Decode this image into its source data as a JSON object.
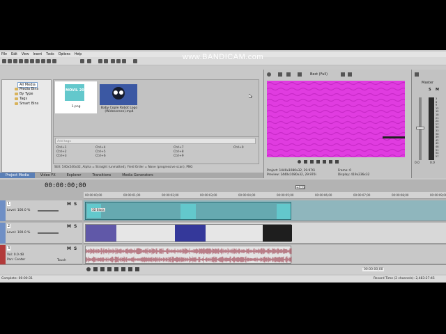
{
  "watermark": "www.BANDICAM.com",
  "menu": [
    "File",
    "Edit",
    "View",
    "Insert",
    "Tools",
    "Options",
    "Help"
  ],
  "explorer_tree": [
    "All Media",
    "Media Bins",
    "By Type",
    "Tags",
    "Smart Bins"
  ],
  "media": [
    {
      "label": "1.png",
      "thumb_text": "MOVIL 2019"
    },
    {
      "label": "Baby Cople Robot Logo (Widescreen).mp4",
      "thumb_text": ""
    }
  ],
  "tags_placeholder": "Add tags",
  "shortcuts": [
    "Ctrl+1",
    "Ctrl+2",
    "Ctrl+3",
    "Ctrl+4",
    "Ctrl+5",
    "Ctrl+6",
    "Ctrl+7",
    "Ctrl+8",
    "Ctrl+9",
    "Ctrl+0"
  ],
  "media_info": "Still: 540x540x32, Alpha = Straight (unmatted), Field Order = None (progressive scan), PNG",
  "left_tabs": [
    "Project Media",
    "Video FX",
    "Explorer",
    "Transitions",
    "Media Generators"
  ],
  "preview": {
    "quality": "Best (Full)",
    "project": "1440x1080x32, 29.970i",
    "preview_res": "1440x1080x32, 29.970i",
    "frame": "0",
    "display": "419x236x32",
    "project_label": "Project:",
    "preview_label": "Preview:",
    "frame_label": "Frame:",
    "display_label": "Display:"
  },
  "master": {
    "label": "Master",
    "left": "0.0",
    "right": "0.0",
    "db_scale": [
      "3",
      "6",
      "9",
      "12",
      "15",
      "18",
      "21",
      "24",
      "27",
      "30",
      "33",
      "36",
      "39",
      "42",
      "45",
      "48",
      "51",
      "54",
      "57"
    ]
  },
  "timeline": {
    "timecode": "00:00:00;00",
    "ruler": [
      "00:00:00;00",
      "00:00:01;00",
      "00:00:02;00",
      "00:00:03;00",
      "00:00:04;00",
      "00:00:05;00",
      "00:00:06;00",
      "00:00:07;00",
      "00:00:08;00",
      "00:00:09;00"
    ],
    "marker": "+4;23",
    "tracks": [
      {
        "num": "1",
        "level": "Level: 100.0 %",
        "m": "M",
        "s": "S"
      },
      {
        "num": "2",
        "level": "Level: 100.0 %",
        "m": "M",
        "s": "S"
      },
      {
        "num": "3",
        "vol": "Vol:",
        "vol_val": "0.0 dB",
        "pan": "Pan:",
        "pan_val": "Center",
        "touch": "Touch",
        "m": "M",
        "s": "S"
      }
    ],
    "clip_label": "3D Block",
    "rate": "Rate: 0.00",
    "end_time": "00:00:00;00"
  },
  "status": {
    "complete": "Complete: 00:00:31",
    "record": "Record Time (2 channels): 2,483:27:45"
  }
}
